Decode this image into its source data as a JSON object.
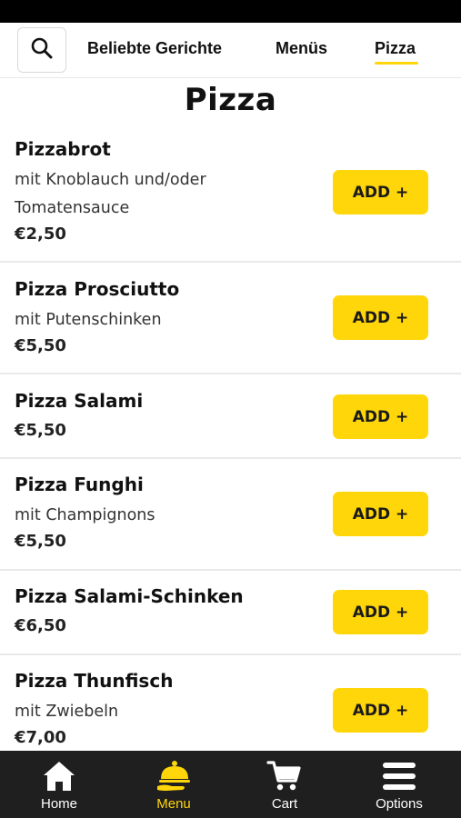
{
  "nav": {
    "tabs": [
      "Beliebte Gerichte",
      "Menüs",
      "Pizza"
    ],
    "active_tab": "Pizza"
  },
  "section_title": "Pizza",
  "items": [
    {
      "name": "Pizzabrot",
      "description": "mit Knoblauch und/oder Tomatensauce",
      "price": "€2,50",
      "button": "ADD +"
    },
    {
      "name": "Pizza Prosciutto",
      "description": "mit Putenschinken",
      "price": "€5,50",
      "button": "ADD +"
    },
    {
      "name": "Pizza Salami",
      "description": "",
      "price": "€5,50",
      "button": "ADD +"
    },
    {
      "name": "Pizza Funghi",
      "description": "mit Champignons",
      "price": "€5,50",
      "button": "ADD +"
    },
    {
      "name": "Pizza Salami-Schinken",
      "description": "",
      "price": "€6,50",
      "button": "ADD +"
    },
    {
      "name": "Pizza Thunfisch",
      "description": "mit Zwiebeln",
      "price": "€7,00",
      "button": "ADD +"
    }
  ],
  "bottom_nav": [
    {
      "label": "Home",
      "icon": "home-icon",
      "active": false
    },
    {
      "label": "Menu",
      "icon": "cloche-icon",
      "active": true
    },
    {
      "label": "Cart",
      "icon": "cart-icon",
      "active": false
    },
    {
      "label": "Options",
      "icon": "hamburger-icon",
      "active": false
    }
  ],
  "colors": {
    "accent": "#ffd60a",
    "bottom_bar": "#1f1f1f",
    "status_bar": "#000000"
  }
}
